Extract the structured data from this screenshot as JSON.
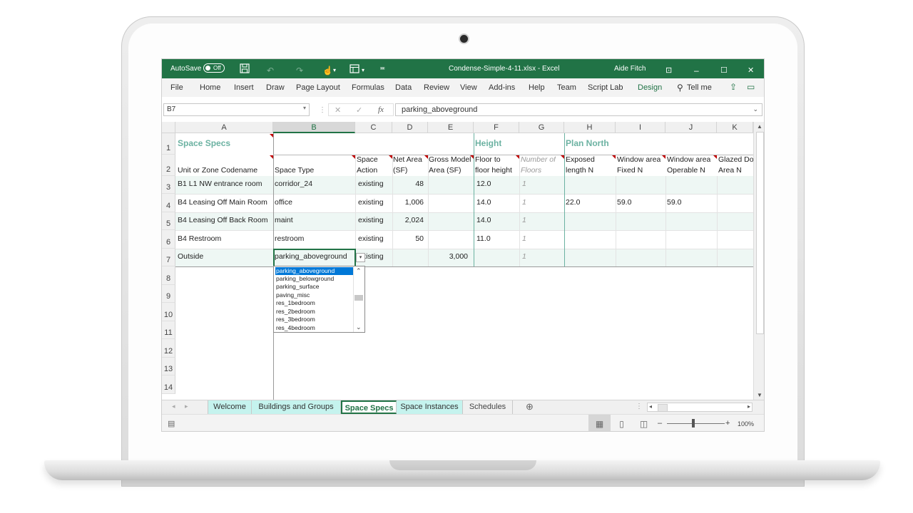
{
  "titlebar": {
    "autosave_label": "AutoSave",
    "autosave_state": "Off",
    "more_icon": "•",
    "file_title": "Condense-Simple-4-11.xlsx  -  Excel",
    "user": "Aide Fitch",
    "minimize": "–",
    "maximize": "☐",
    "close": "✕"
  },
  "ribbon": {
    "menus": [
      "File",
      "Home",
      "Insert",
      "Draw",
      "Page Layout",
      "Formulas",
      "Data",
      "Review",
      "View",
      "Add-ins",
      "Help",
      "Team",
      "Script Lab",
      "Design"
    ],
    "tell_me": "Tell me"
  },
  "formula_bar": {
    "name_box": "B7",
    "fx": "fx",
    "value": "parking_aboveground"
  },
  "columns": [
    "A",
    "B",
    "C",
    "D",
    "E",
    "F",
    "G",
    "H",
    "I",
    "J",
    "K"
  ],
  "rows": [
    "1",
    "2",
    "3",
    "4",
    "5",
    "6",
    "7",
    "8",
    "9",
    "10",
    "11",
    "12",
    "13",
    "14"
  ],
  "sections": {
    "space_specs": "Space Specs",
    "height": "Height",
    "plan_north": "Plan North"
  },
  "headers": {
    "a": "Unit or Zone Codename",
    "b": "Space Type",
    "c1": "Space",
    "c2": "Action",
    "d1": "Net Area",
    "d2": "(SF)",
    "e1": "Gross Model",
    "e2": "Area (SF)",
    "f1": "Floor to",
    "f2": "floor height",
    "g1": "Number of",
    "g2": "Floors",
    "h1": "Exposed",
    "h2": "length N",
    "i1": "Window area",
    "i2": "Fixed N",
    "j1": "Window area",
    "j2": "Operable N",
    "k1": "Glazed Do",
    "k2": "Area N"
  },
  "data_rows": [
    {
      "a": "B1 L1 NW entrance room",
      "b": "corridor_24",
      "c": "existing",
      "d": "48",
      "e": "",
      "f": "12.0",
      "g": "1",
      "h": "",
      "i": "",
      "j": ""
    },
    {
      "a": "B4 Leasing Off Main Room",
      "b": "office",
      "c": "existing",
      "d": "1,006",
      "e": "",
      "f": "14.0",
      "g": "1",
      "h": "22.0",
      "i": "59.0",
      "j": "59.0"
    },
    {
      "a": "B4 Leasing Off Back Room",
      "b": "maint",
      "c": "existing",
      "d": "2,024",
      "e": "",
      "f": "14.0",
      "g": "1",
      "h": "",
      "i": "",
      "j": ""
    },
    {
      "a": "B4 Restroom",
      "b": "restroom",
      "c": "existing",
      "d": "50",
      "e": "",
      "f": "11.0",
      "g": "1",
      "h": "",
      "i": "",
      "j": ""
    },
    {
      "a": "Outside",
      "b": "parking_aboveground",
      "c": "existing",
      "d": "",
      "e": "3,000",
      "f": "",
      "g": "1",
      "h": "",
      "i": "",
      "j": ""
    }
  ],
  "dropdown": {
    "options": [
      "parking_aboveground",
      "parking_belowground",
      "parking_surface",
      "paving_misc",
      "res_1bedroom",
      "res_2bedroom",
      "res_3bedroom",
      "res_4bedroom"
    ],
    "selected_index": 0
  },
  "sheet_tabs": [
    {
      "label": "Welcome"
    },
    {
      "label": "Buildings and Groups"
    },
    {
      "label": "Space Specs"
    },
    {
      "label": "Space Instances"
    },
    {
      "label": "Schedules"
    }
  ],
  "active_tab": "Space Specs",
  "status": {
    "zoom": "100%",
    "minus": "–",
    "plus": "+"
  },
  "colors": {
    "excel_green": "#217346",
    "section_teal": "#6cb2a2",
    "tab_cyan": "#c5f3ee",
    "band": "#eef7f4"
  }
}
